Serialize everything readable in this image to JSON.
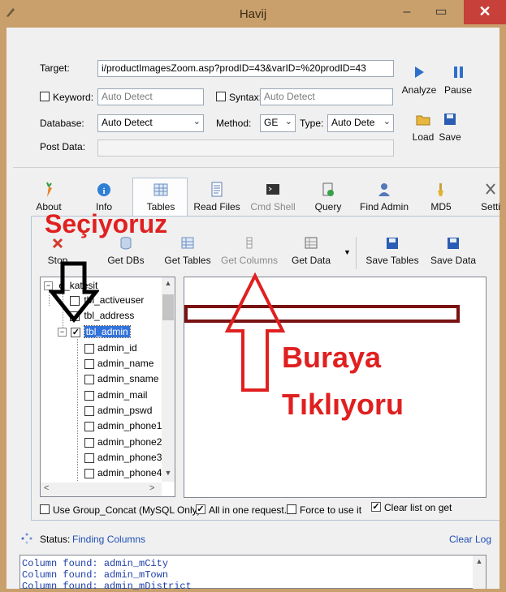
{
  "window": {
    "title": "Havij"
  },
  "form": {
    "target_label": "Target:",
    "target_value": "i/productImagesZoom.asp?prodID=43&varID=%20prodID=43",
    "keyword_label": "Keyword:",
    "keyword_placeholder": "Auto Detect",
    "syntax_label": "Syntax:",
    "syntax_placeholder": "Auto Detect",
    "database_label": "Database:",
    "database_value": "Auto Detect",
    "method_label": "Method:",
    "method_value": "GE",
    "type_label": "Type:",
    "type_value": "Auto Dete",
    "postdata_label": "Post Data:"
  },
  "actions": {
    "analyze": "Analyze",
    "pause": "Pause",
    "load": "Load",
    "save": "Save"
  },
  "main_tabs": [
    "About",
    "Info",
    "Tables",
    "Read Files",
    "Cmd Shell",
    "Query",
    "Find Admin",
    "MD5",
    "Setti"
  ],
  "table_toolbar": {
    "stop": "Stop",
    "get_dbs": "Get DBs",
    "get_tables": "Get Tables",
    "get_columns": "Get Columns",
    "get_data": "Get Data",
    "save_tables": "Save Tables",
    "save_data": "Save Data"
  },
  "tree": {
    "root": "e_katesit",
    "tables": [
      "tbl_activeuser",
      "tbl_address",
      "tbl_admin"
    ],
    "columns": [
      "admin_id",
      "admin_name",
      "admin_sname",
      "admin_mail",
      "admin_pswd",
      "admin_phone1",
      "admin_phone2",
      "admin_phone3",
      "admin_phone4"
    ]
  },
  "options": {
    "group_concat": "Use Group_Concat (MySQL Only)",
    "all_in_one": "All in one request.",
    "force": "Force to use it",
    "clear_list": "Clear list on get"
  },
  "status": {
    "label": "Status:",
    "value": "Finding Columns",
    "clear_log": "Clear Log"
  },
  "log_lines": [
    "Column found: admin_mCity",
    "Column found: admin_mTown",
    "Column found: admin_mDistrict"
  ],
  "annotations": {
    "seciyoruz": "Seçiyoruz",
    "buraya": "Buraya",
    "tikliyoru": "Tıklıyoru",
    "color": "#e02020"
  }
}
